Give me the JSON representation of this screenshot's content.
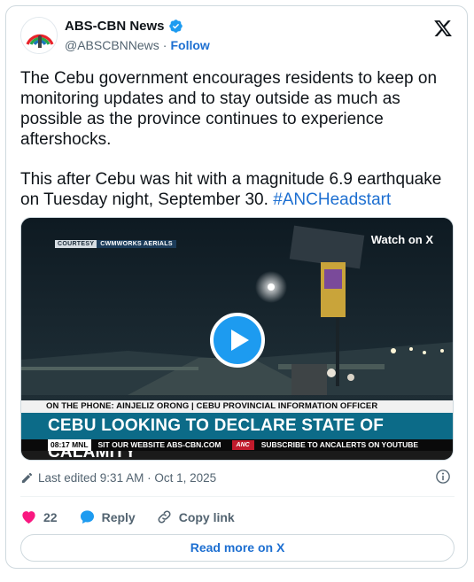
{
  "author": {
    "display_name": "ABS-CBN News",
    "handle": "@ABSCBNNews",
    "separator": "·",
    "follow_label": "Follow",
    "logo_icon": "abs-cbn-logo",
    "verified_icon": "verified-badge-icon"
  },
  "tweet": {
    "paragraph1": "The Cebu government encourages residents to keep on monitoring updates and to stay outside as much as possible as the province continues to experience aftershocks.",
    "paragraph2_prefix": "This after Cebu was hit with a magnitude 6.9 earthquake on Tuesday night, September 30. ",
    "hashtag": "#ANCHeadstart"
  },
  "media": {
    "courtesy_label": "COURTESY",
    "courtesy_source": "CWMWORKS AERIALS",
    "watch_label": "Watch on X",
    "phone_bar": "ON THE PHONE: AINJELIZ ORONG | CEBU PROVINCIAL INFORMATION OFFICER",
    "headline": "CEBU LOOKING TO DECLARE STATE OF CALAMITY",
    "ticker_time": "08:17 MNL",
    "ticker_text1": "SIT OUR WEBSITE ABS-CBN.COM",
    "ticker_logo": "ANC",
    "ticker_text2": "SUBSCRIBE TO ANCALERTS ON YOUTUBE"
  },
  "meta": {
    "edited_text": "Last edited 9:31 AM · Oct 1, 2025"
  },
  "actions": {
    "like_count": "22",
    "reply_label": "Reply",
    "copy_link_label": "Copy link"
  },
  "read_more_label": "Read more on X",
  "colors": {
    "link_blue": "#1d6fd1",
    "like_pink": "#f91880",
    "play_blue": "#1d9bf0",
    "headline_teal": "#0c6b88"
  }
}
